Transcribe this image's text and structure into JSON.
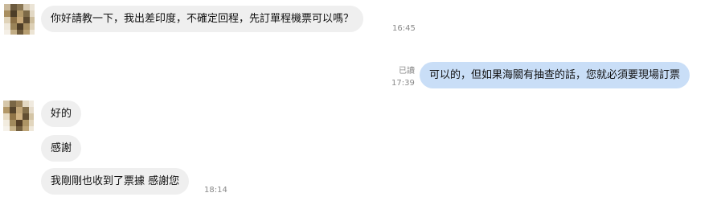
{
  "messages": [
    {
      "text": "你好請教一下，我出差印度，不確定回程，先訂單程機票可以嗎？",
      "time": "16:45"
    },
    {
      "text": "可以的，但如果海關有抽查的話，您就必須要現場訂票",
      "read_status": "已讀",
      "time": "17:39"
    },
    {
      "text": "好的"
    },
    {
      "text": "感謝"
    },
    {
      "text": "我剛剛也收到了票據 感謝您",
      "time": "18:14"
    }
  ],
  "colors": {
    "incoming_bubble": "#efefef",
    "outgoing_bubble": "#c9def7",
    "timestamp": "#8a8a8a"
  }
}
